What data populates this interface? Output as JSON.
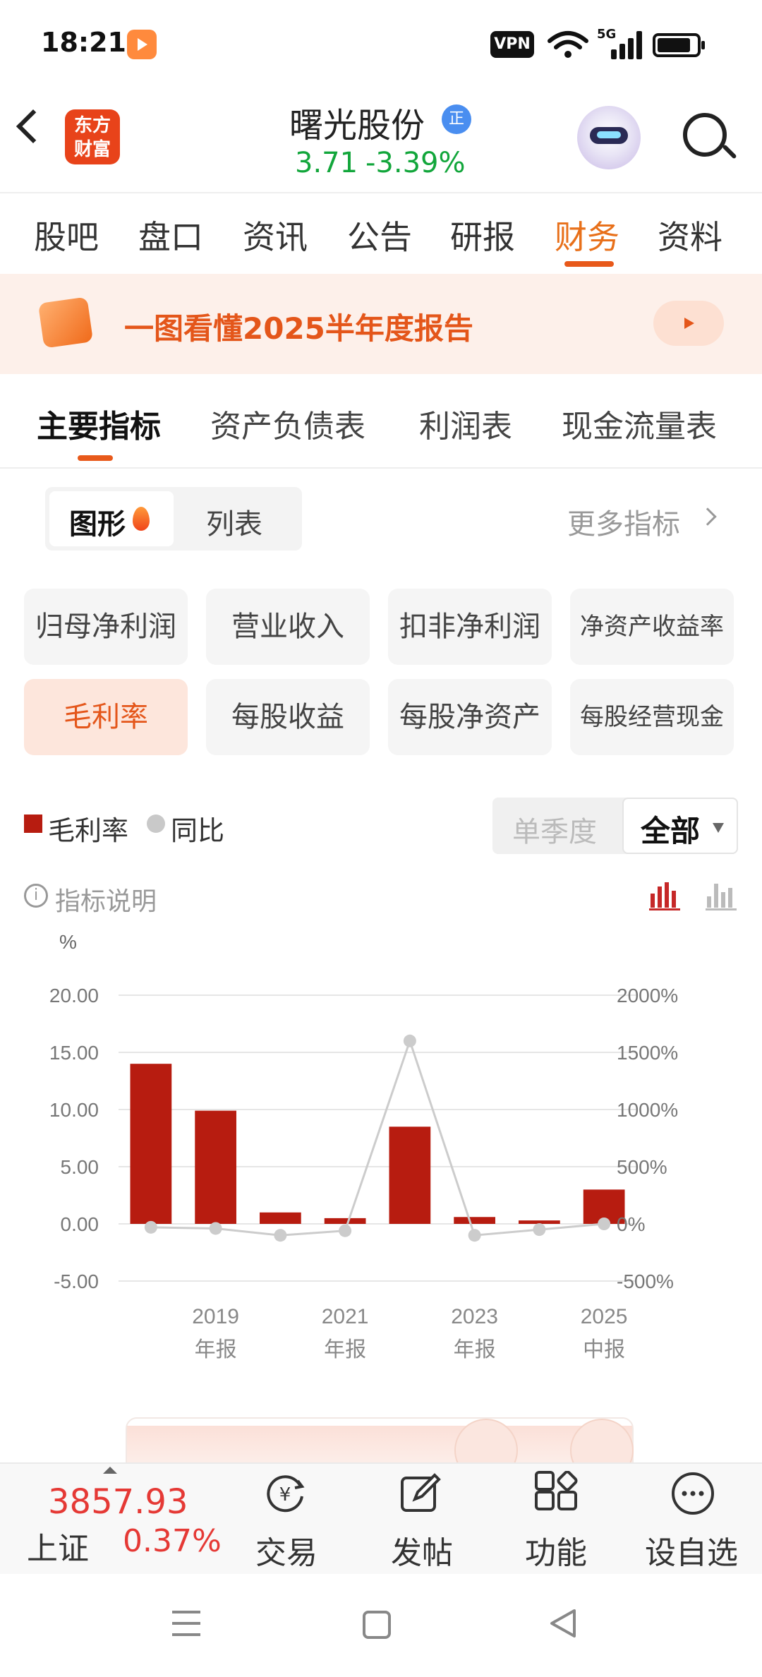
{
  "status_bar": {
    "time": "18:21",
    "vpn": "VPN",
    "network": "5G"
  },
  "header": {
    "logo_text": "东方\n财富",
    "stock_name": "曙光股份",
    "badge": "正",
    "price": "3.71",
    "change": "-3.39%"
  },
  "main_tabs": [
    {
      "label": "股吧"
    },
    {
      "label": "盘口"
    },
    {
      "label": "资讯"
    },
    {
      "label": "公告"
    },
    {
      "label": "研报"
    },
    {
      "label": "财务"
    },
    {
      "label": "资料"
    }
  ],
  "banner": {
    "text": "一图看懂2025半年度报告"
  },
  "sub_tabs": [
    {
      "label": "主要指标"
    },
    {
      "label": "资产负债表"
    },
    {
      "label": "利润表"
    },
    {
      "label": "现金流量表"
    }
  ],
  "view_toggle": {
    "chart": "图形",
    "list": "列表"
  },
  "more_metrics": "更多指标",
  "metrics": [
    {
      "label": "归母净利润"
    },
    {
      "label": "营业收入"
    },
    {
      "label": "扣非净利润"
    },
    {
      "label": "净资产收益率"
    },
    {
      "label": "毛利率"
    },
    {
      "label": "每股收益"
    },
    {
      "label": "每股净资产"
    },
    {
      "label": "每股经营现金"
    }
  ],
  "legend": {
    "bar": "毛利率",
    "line": "同比"
  },
  "period": {
    "single": "单季度",
    "all": "全部"
  },
  "info_text": "指标说明",
  "colors": {
    "accent": "#e8701a",
    "bar": "#b71c10",
    "line": "#cccccc",
    "up": "#e53935",
    "down": "#12a63b"
  },
  "chart_data": {
    "type": "bar",
    "ylabel": "%",
    "ylim": [
      -5,
      20
    ],
    "y_ticks": [
      "20.00",
      "15.00",
      "10.00",
      "5.00",
      "0.00",
      "-5.00"
    ],
    "y2lim": [
      -500,
      2000
    ],
    "y2_ticks": [
      "2000%",
      "1500%",
      "1000%",
      "500%",
      "0%",
      "-500%"
    ],
    "x_ticks": [
      {
        "index": 1,
        "year": "2019",
        "kind": "年报"
      },
      {
        "index": 3,
        "year": "2021",
        "kind": "年报"
      },
      {
        "index": 5,
        "year": "2023",
        "kind": "年报"
      },
      {
        "index": 7,
        "year": "2025",
        "kind": "中报"
      }
    ],
    "series": [
      {
        "name": "毛利率",
        "type": "bar",
        "values": [
          14.0,
          9.9,
          1.0,
          0.5,
          8.5,
          0.6,
          0.3,
          3.0
        ]
      },
      {
        "name": "同比",
        "type": "line",
        "values": [
          -30,
          -40,
          -100,
          -60,
          1600,
          -100,
          -50,
          0
        ]
      }
    ]
  },
  "bottom_bar": {
    "index_value": "3857.93",
    "index_name": "上证",
    "index_change": "0.37%",
    "nav": [
      {
        "label": "交易"
      },
      {
        "label": "发帖"
      },
      {
        "label": "功能"
      },
      {
        "label": "设自选"
      }
    ]
  }
}
